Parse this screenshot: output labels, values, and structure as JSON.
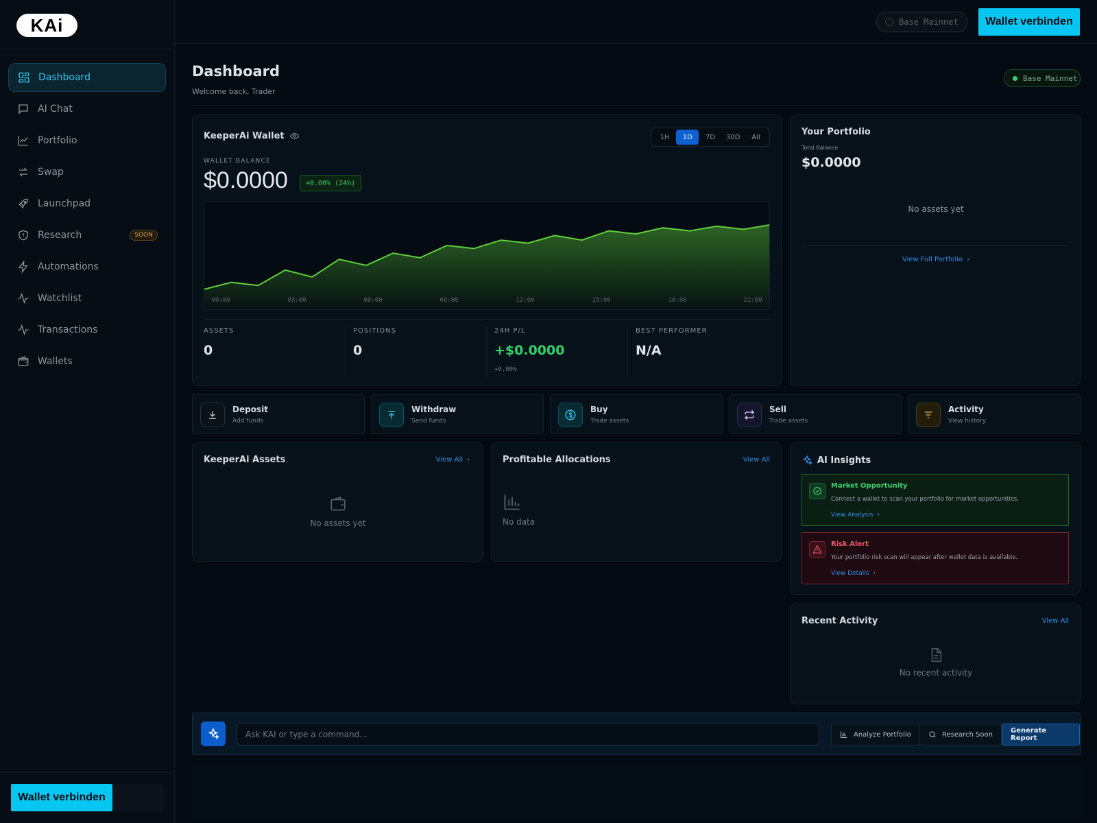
{
  "app": {
    "logo_text": "KAi"
  },
  "sidebar": {
    "items": [
      {
        "label": "Dashboard",
        "icon": "dashboard-grid-icon",
        "active": true
      },
      {
        "label": "AI Chat",
        "icon": "chat-bubble-icon"
      },
      {
        "label": "Portfolio",
        "icon": "line-chart-icon"
      },
      {
        "label": "Swap",
        "icon": "swap-arrows-icon"
      },
      {
        "label": "Launchpad",
        "icon": "rocket-icon"
      },
      {
        "label": "Research",
        "icon": "shield-icon",
        "badge": "SOON"
      },
      {
        "label": "Automations",
        "icon": "lightning-icon"
      },
      {
        "label": "Watchlist",
        "icon": "activity-icon"
      },
      {
        "label": "Transactions",
        "icon": "activity-icon"
      },
      {
        "label": "Wallets",
        "icon": "wallet-icon"
      }
    ],
    "connect_label": "Wallet verbinden"
  },
  "topbar": {
    "network": "Base Mainnet",
    "connect_label": "Wallet verbinden"
  },
  "header": {
    "title": "Dashboard",
    "subtitle": "Welcome back, Trader",
    "network": "Base Mainnet"
  },
  "wallet_card": {
    "title": "KeeperAi Wallet",
    "timeframes": [
      "1H",
      "1D",
      "7D",
      "30D",
      "All"
    ],
    "active_timeframe": "1D",
    "balance_label": "WALLET BALANCE",
    "balance": "$0.0000",
    "change": "+0.00% (24h)",
    "stats": [
      {
        "label": "ASSETS",
        "value": "0"
      },
      {
        "label": "POSITIONS",
        "value": "0"
      },
      {
        "label": "24H P/L",
        "value": "+$0.0000",
        "sub": "+0.00%"
      },
      {
        "label": "BEST PERFORMER",
        "value": "N/A"
      }
    ]
  },
  "chart_data": {
    "type": "area",
    "x": [
      "00:00",
      "01:00",
      "02:00",
      "03:00",
      "04:00",
      "05:00",
      "06:00",
      "07:00",
      "08:00",
      "09:00",
      "10:00",
      "11:00",
      "12:00",
      "13:00",
      "14:00",
      "15:00",
      "16:00",
      "17:00",
      "18:00",
      "19:00",
      "20:00",
      "21:00"
    ],
    "tick_labels": [
      "00:00",
      "03:00",
      "06:00",
      "09:00",
      "12:00",
      "15:00",
      "18:00",
      "21:00"
    ],
    "values": [
      2,
      11,
      7,
      27,
      18,
      41,
      33,
      49,
      43,
      59,
      55,
      66,
      62,
      72,
      66,
      78,
      74,
      82,
      78,
      84,
      80,
      86
    ],
    "color": "#5fd13a",
    "grid": false
  },
  "portfolio_card": {
    "title": "Your Portfolio",
    "total_label": "Total Balance",
    "total": "$0.0000",
    "empty": "No assets yet",
    "link": "View Full Portfolio"
  },
  "quick_actions": [
    {
      "title": "Deposit",
      "sub": "Add funds",
      "icon": "download-icon",
      "color": "#9aa3ad"
    },
    {
      "title": "Withdraw",
      "sub": "Send funds",
      "icon": "upload-icon",
      "color": "#2ec8ee"
    },
    {
      "title": "Buy",
      "sub": "Trade assets",
      "icon": "dollar-circle-icon",
      "color": "#2ec8ee"
    },
    {
      "title": "Sell",
      "sub": "Trade assets",
      "icon": "repeat-icon",
      "color": "#d0d7ff"
    },
    {
      "title": "Activity",
      "sub": "View history",
      "icon": "filter-lines-icon",
      "color": "#e0b34a"
    }
  ],
  "assets_card": {
    "title": "KeeperAi Assets",
    "link": "View All",
    "empty": "No assets yet"
  },
  "allocations_card": {
    "title": "Profitable Allocations",
    "link": "View All",
    "empty": "No data"
  },
  "ai_insights": {
    "title": "AI Insights",
    "alerts": [
      {
        "title": "Market Opportunity",
        "text": "Connect a wallet to scan your portfolio for market opportunities.",
        "link": "View Analysis",
        "color": "#3fd070"
      },
      {
        "title": "Risk Alert",
        "text": "Your portfolio risk scan will appear after wallet data is available.",
        "link": "View Details",
        "color": "#f0566a"
      }
    ]
  },
  "recent_activity": {
    "title": "Recent Activity",
    "link": "View All",
    "empty": "No recent activity"
  },
  "command_bar": {
    "placeholder": "Ask KAI or type a command...",
    "analyze_label": "Analyze Portfolio",
    "research_label": "Research Soon",
    "generate_label": "Generate Report"
  }
}
